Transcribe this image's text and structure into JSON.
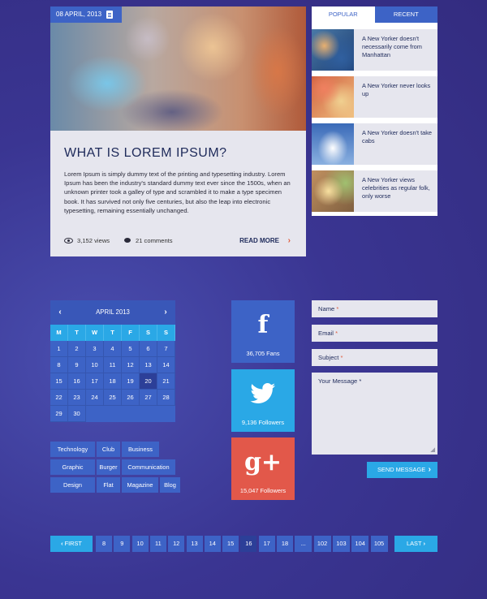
{
  "article": {
    "date": "08 APRIL, 2013",
    "title": "WHAT IS LOREM IPSUM?",
    "body": "Lorem Ipsum is simply dummy text of the printing and typesetting industry. Lorem Ipsum has been the industry's standard dummy text ever since the 1500s, when an unknown printer took a galley of type and scrambled it to make a type specimen book. It has survived not only five centuries, but also the leap into electronic typesetting, remaining essentially unchanged.",
    "views": "3,152 views",
    "comments": "21 comments",
    "read_more": "READ MORE"
  },
  "sidebar": {
    "tabs": [
      {
        "label": "POPULAR"
      },
      {
        "label": "RECENT"
      }
    ],
    "posts": [
      {
        "title": "A New Yorker doesn't necessarily come from Manhattan"
      },
      {
        "title": "A New Yorker never looks up"
      },
      {
        "title": "A New Yorker doesn't take cabs"
      },
      {
        "title": "A New Yorker views celebrities as regular folk, only worse"
      }
    ]
  },
  "calendar": {
    "month": "APRIL 2013",
    "weekdays": [
      "M",
      "T",
      "W",
      "T",
      "F",
      "S",
      "S"
    ],
    "days": [
      "1",
      "2",
      "3",
      "4",
      "5",
      "6",
      "7",
      "8",
      "9",
      "10",
      "11",
      "12",
      "13",
      "14",
      "15",
      "16",
      "17",
      "18",
      "19",
      "20",
      "21",
      "22",
      "23",
      "24",
      "25",
      "26",
      "27",
      "28",
      "29",
      "30"
    ],
    "today": "20"
  },
  "tags": [
    "Technology",
    "Club",
    "Business",
    "Graphic",
    "Burger",
    "Communication",
    "Design",
    "Flat",
    "Magazine",
    "Blog"
  ],
  "social": {
    "facebook": {
      "icon": "f",
      "count": "36,705 Fans",
      "color": "#3d63c6"
    },
    "twitter": {
      "count": "9,136 Followers",
      "color": "#2aa8e6"
    },
    "googleplus": {
      "icon": "g+",
      "count": "15,047 Followers",
      "color": "#e2584a"
    }
  },
  "form": {
    "name": "Name",
    "email": "Email",
    "subject": "Subject",
    "message": "Your Message",
    "required_mark": "*",
    "send": "SEND MESSAGE"
  },
  "pagination": {
    "first": "FIRST",
    "last": "LAST",
    "pages": [
      "8",
      "9",
      "10",
      "11",
      "12",
      "13",
      "14",
      "15",
      "16",
      "17",
      "18",
      "...",
      "102",
      "103",
      "104",
      "105"
    ],
    "current": "16"
  }
}
